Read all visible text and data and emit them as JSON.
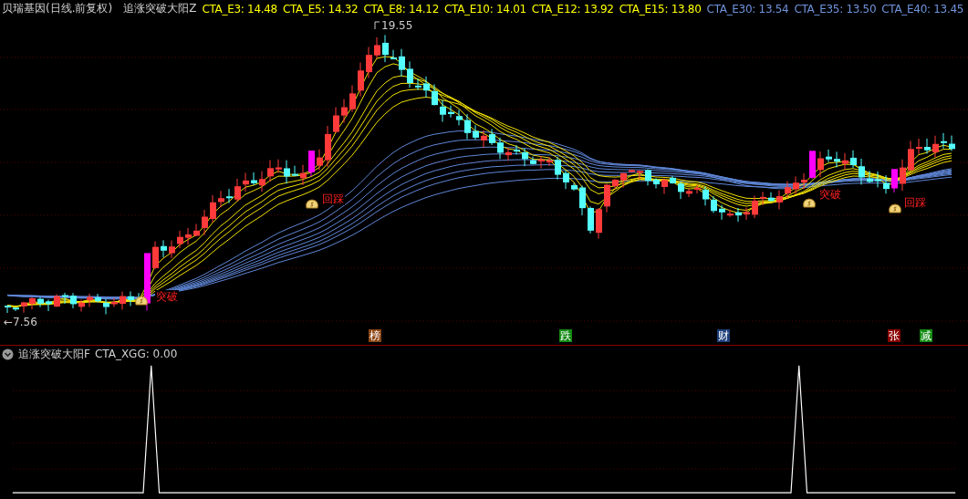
{
  "header": {
    "stock": "贝瑞基因(日线.前复权)",
    "indicator": "追涨突破大阳Z"
  },
  "ma_values": [
    {
      "label": "CTA_E3:",
      "value": "14.48",
      "color": "#ffff00"
    },
    {
      "label": "CTA_E5:",
      "value": "14.32",
      "color": "#ffff00"
    },
    {
      "label": "CTA_E8:",
      "value": "14.12",
      "color": "#ffff00"
    },
    {
      "label": "CTA_E10:",
      "value": "14.01",
      "color": "#ffff00"
    },
    {
      "label": "CTA_E12:",
      "value": "13.92",
      "color": "#ffff00"
    },
    {
      "label": "CTA_E15:",
      "value": "13.80",
      "color": "#ffff00"
    },
    {
      "label": "CTA_E30:",
      "value": "13.54",
      "color": "#6f93dc"
    },
    {
      "label": "CTA_E35:",
      "value": "13.50",
      "color": "#6f93dc"
    },
    {
      "label": "CTA_E40:",
      "value": "13.45",
      "color": "#6f93dc"
    }
  ],
  "price_labels": [
    {
      "kind": "high",
      "text": "19.55"
    },
    {
      "kind": "low",
      "text": "←7.56"
    }
  ],
  "signals": [
    {
      "kind": "breakout",
      "text": "突破"
    },
    {
      "kind": "pullback",
      "text": "回踩"
    },
    {
      "kind": "breakout",
      "text": "突破"
    },
    {
      "kind": "pullback",
      "text": "回踩"
    }
  ],
  "event_tags": [
    {
      "text": "榜",
      "color": "#8b4513"
    },
    {
      "text": "跌",
      "color": "#138a13"
    },
    {
      "text": "财",
      "color": "#1c3f7a"
    },
    {
      "text": "张",
      "color": "#8b0000"
    },
    {
      "text": "减",
      "color": "#138a13"
    }
  ],
  "sub_pane": {
    "indicator": "追涨突破大阳F",
    "label": "CTA_XGG:",
    "value": "0.00"
  }
}
